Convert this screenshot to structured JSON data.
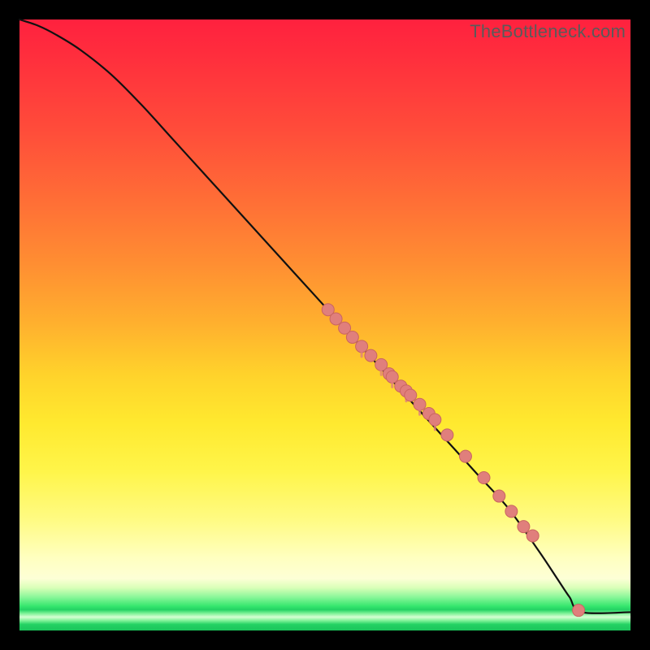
{
  "watermark": "TheBottleneck.com",
  "colors": {
    "curve": "#111111",
    "point_fill": "#e07f7c",
    "point_stroke": "#c96560"
  },
  "chart_data": {
    "type": "line",
    "title": "",
    "xlabel": "",
    "ylabel": "",
    "xlim": [
      0,
      100
    ],
    "ylim": [
      0,
      100
    ],
    "grid": false,
    "legend": false,
    "note": "Axes have no visible tick labels; values are normalized 0–100 on both axes, estimated from pixel positions.",
    "series": [
      {
        "name": "curve",
        "kind": "line",
        "color": "#111111",
        "x": [
          0,
          3,
          6,
          10,
          15,
          20,
          25,
          30,
          35,
          40,
          45,
          50,
          55,
          60,
          65,
          70,
          75,
          80,
          85,
          88,
          90,
          92,
          100
        ],
        "y": [
          100,
          99,
          97.5,
          95,
          91,
          86,
          80.5,
          75,
          69.5,
          64,
          58.5,
          53,
          47.5,
          42,
          36.5,
          31,
          25.5,
          20,
          13,
          8.5,
          5.5,
          3,
          3
        ]
      },
      {
        "name": "points",
        "kind": "scatter",
        "color": "#e07f7c",
        "x": [
          50.5,
          51.8,
          53.2,
          54.5,
          56.0,
          57.5,
          59.2,
          60.5,
          61.0,
          62.4,
          63.3,
          64.0,
          65.5,
          67.0,
          68.0,
          70.0,
          73.0,
          76.0,
          78.5,
          80.5,
          82.5,
          84.0,
          91.5
        ],
        "y": [
          52.5,
          51.0,
          49.5,
          48.0,
          46.5,
          45.0,
          43.5,
          42.0,
          41.5,
          40.0,
          39.2,
          38.5,
          37.0,
          35.5,
          34.5,
          32.0,
          28.5,
          25.0,
          22.0,
          19.5,
          17.0,
          15.5,
          3.3
        ]
      }
    ]
  }
}
